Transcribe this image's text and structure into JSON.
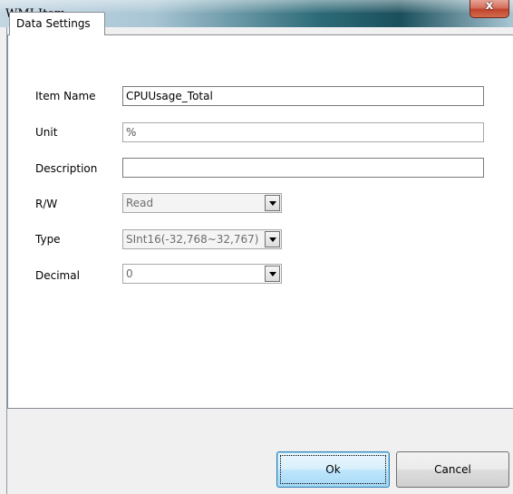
{
  "window": {
    "title": "WMI Item",
    "close_glyph": "x"
  },
  "tabs": [
    {
      "label": "Data Settings"
    }
  ],
  "form": {
    "item_name": {
      "label": "Item Name",
      "value": "CPUUsage_Total"
    },
    "unit": {
      "label": "Unit",
      "value": "%"
    },
    "description": {
      "label": "Description",
      "value": ""
    },
    "rw": {
      "label": "R/W",
      "value": "Read"
    },
    "type": {
      "label": "Type",
      "value": "SInt16(-32,768~32,767)"
    },
    "decimal": {
      "label": "Decimal",
      "value": "0"
    }
  },
  "buttons": {
    "ok": "Ok",
    "cancel": "Cancel"
  },
  "colors": {
    "title_accent": "#1b4f5c",
    "close_button": "#c1442d",
    "default_button": "#3c7fb1"
  }
}
